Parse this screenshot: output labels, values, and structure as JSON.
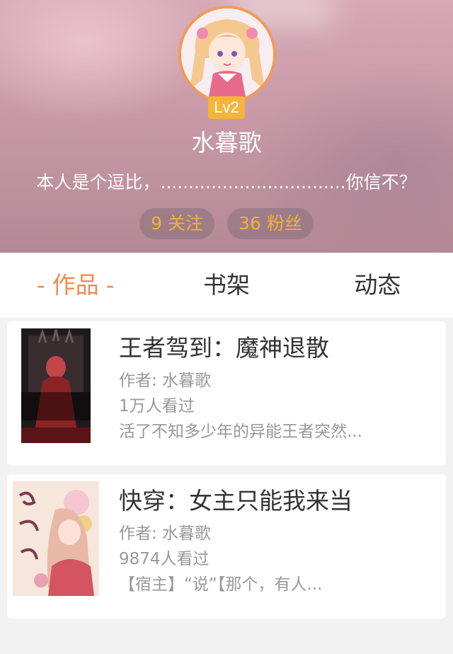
{
  "profile": {
    "level": "Lv2",
    "username": "水暮歌",
    "bio": "本人是个逗比，.................................你信不？",
    "following_count": "9",
    "following_label": "关注",
    "followers_count": "36",
    "followers_label": "粉丝"
  },
  "tabs": [
    {
      "label": "作品",
      "active": true
    },
    {
      "label": "书架",
      "active": false
    },
    {
      "label": "动态",
      "active": false
    }
  ],
  "books": [
    {
      "title": "王者驾到：魔神退散",
      "author": "作者: 水暮歌",
      "views": "1万人看过",
      "summary": "活了不知多少年的异能王者突然...",
      "cover_icon": "dark-throne-cover-image"
    },
    {
      "title": "快穿：女主只能我来当",
      "author": "作者: 水暮歌",
      "views": "9874人看过",
      "summary": "【宿主】“说”【那个，有人...",
      "cover_icon": "anime-girl-cover-image"
    }
  ],
  "colors": {
    "accent": "#f08a4a",
    "level_badge": "#f5b53a",
    "stat_text": "#f0b23a"
  }
}
